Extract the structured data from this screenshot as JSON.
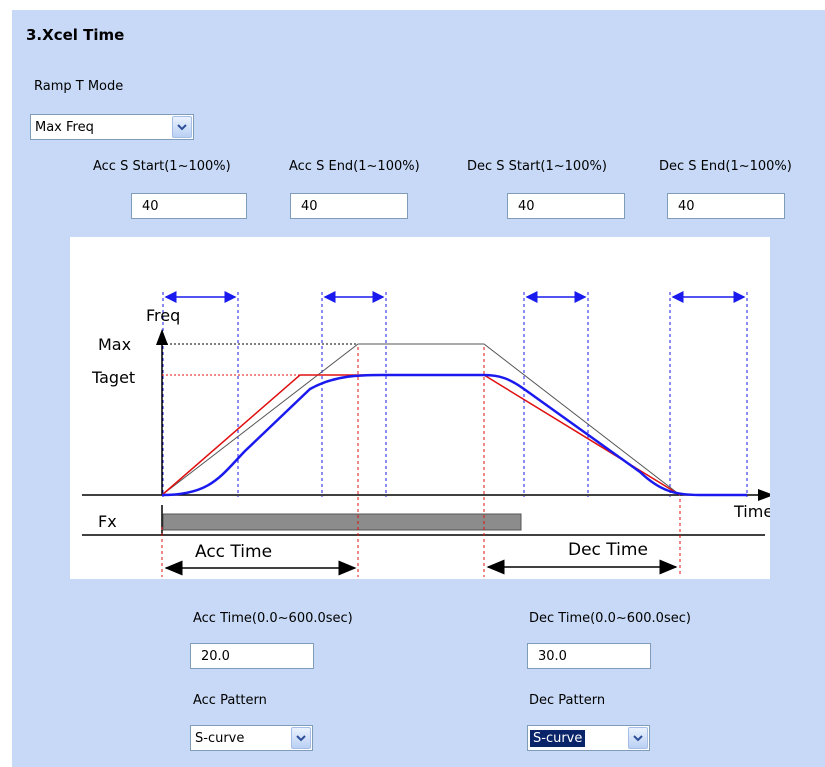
{
  "section": {
    "title": "3.Xcel Time"
  },
  "ramp_mode": {
    "label": "Ramp T Mode",
    "value": "Max Freq"
  },
  "s_params": [
    {
      "label": "Acc S Start(1~100%)",
      "value": "40"
    },
    {
      "label": "Acc S End(1~100%)",
      "value": "40"
    },
    {
      "label": "Dec S Start(1~100%)",
      "value": "40"
    },
    {
      "label": "Dec S End(1~100%)",
      "value": "40"
    }
  ],
  "diagram": {
    "freq_label": "Freq",
    "max_label": "Max",
    "target_label": "Taget",
    "time_label": "Time",
    "fx_label": "Fx",
    "acc_time_label": "Acc Time",
    "dec_time_label": "Dec Time"
  },
  "acc_time": {
    "label": "Acc Time(0.0~600.0sec)",
    "value": "20.0"
  },
  "dec_time": {
    "label": "Dec Time(0.0~600.0sec)",
    "value": "30.0"
  },
  "acc_pattern": {
    "label": "Acc Pattern",
    "value": "S-curve"
  },
  "dec_pattern": {
    "label": "Dec Pattern",
    "value": "S-curve"
  },
  "colors": {
    "panel_bg": "#c7d9f6",
    "s_curve": "#1a1aee",
    "linear_ramp": "#e01010",
    "fx_bar": "#8c8c8c"
  }
}
